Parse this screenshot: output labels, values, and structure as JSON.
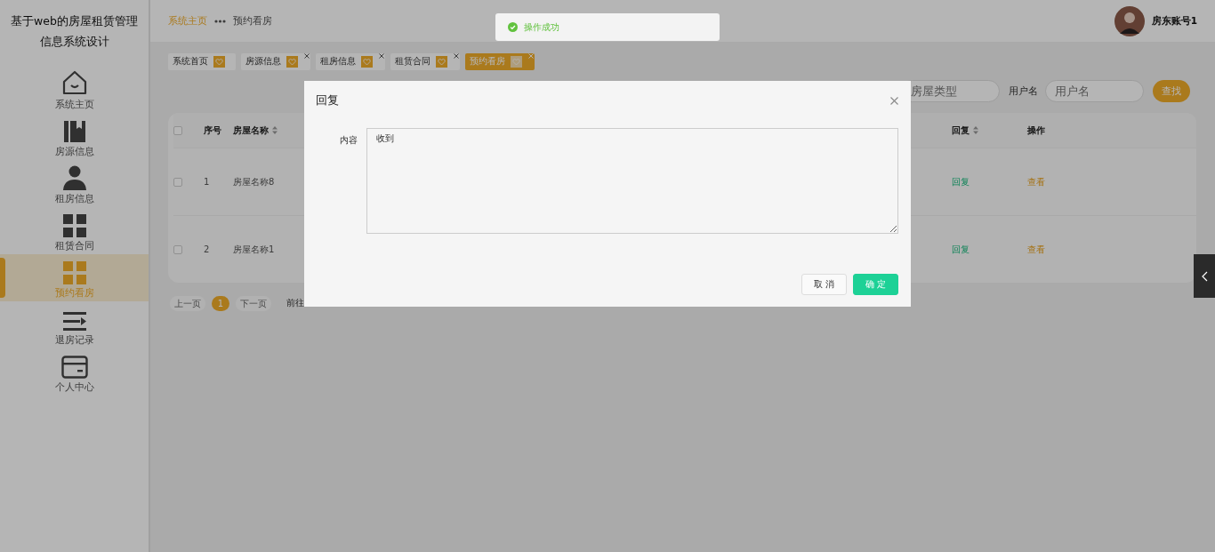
{
  "sidebar": {
    "title": "基于web的房屋租赁管理信息系统设计",
    "items": [
      {
        "label": "系统主页",
        "kind": "home",
        "selected": false
      },
      {
        "label": "房源信息",
        "kind": "book",
        "selected": false
      },
      {
        "label": "租房信息",
        "kind": "person",
        "selected": false
      },
      {
        "label": "租赁合同",
        "kind": "grid",
        "selected": false
      },
      {
        "label": "预约看房",
        "kind": "grid",
        "selected": true
      },
      {
        "label": "退房记录",
        "kind": "list",
        "selected": false
      },
      {
        "label": "个人中心",
        "kind": "card",
        "selected": false
      }
    ]
  },
  "header": {
    "breadcrumb": [
      {
        "label": "系统主页",
        "selected": false
      },
      {
        "label": "预约看房",
        "selected": true
      }
    ],
    "user": "房东账号1"
  },
  "tags": [
    {
      "label": "系统首页",
      "closable": false,
      "selected": false
    },
    {
      "label": "房源信息",
      "closable": true,
      "selected": false
    },
    {
      "label": "租房信息",
      "closable": true,
      "selected": false
    },
    {
      "label": "租赁合同",
      "closable": true,
      "selected": false
    },
    {
      "label": "预约看房",
      "closable": true,
      "selected": true
    }
  ],
  "search": {
    "fields": [
      {
        "placeholder": "房屋类型"
      },
      {
        "label": "用户名",
        "placeholder": "用户名"
      }
    ],
    "button": "查找"
  },
  "table": {
    "all_checked": false,
    "columns": [
      {
        "label": "序号",
        "sortable": false
      },
      {
        "label": "房屋名称",
        "sortable": true
      },
      {
        "label": "回复",
        "sortable": true
      },
      {
        "label": "操作",
        "sortable": false
      }
    ],
    "rows": [
      {
        "checked": false,
        "cells": [
          {
            "kind": "text",
            "text": "1"
          },
          {
            "kind": "text",
            "text": "房屋名称8"
          },
          {
            "kind": "reply",
            "text": "回复"
          },
          {
            "kind": "view",
            "text": "查看"
          }
        ]
      },
      {
        "checked": false,
        "cells": [
          {
            "kind": "text",
            "text": "2"
          },
          {
            "kind": "text",
            "text": "房屋名称1"
          },
          {
            "kind": "reply",
            "text": "回复"
          },
          {
            "kind": "view",
            "text": "查看"
          }
        ]
      }
    ]
  },
  "pagination": {
    "prev": "上一页",
    "pages": [
      {
        "label": "1",
        "selected": true
      }
    ],
    "next": "下一页",
    "goto": "前往"
  },
  "dialog": {
    "title": "回复",
    "field_label": "内容",
    "field_value": "收到",
    "buttons": [
      {
        "label": "取 消",
        "kind": "default"
      },
      {
        "label": "确 定",
        "kind": "primary"
      }
    ]
  },
  "toast": {
    "text": "操作成功",
    "kind": "success"
  }
}
